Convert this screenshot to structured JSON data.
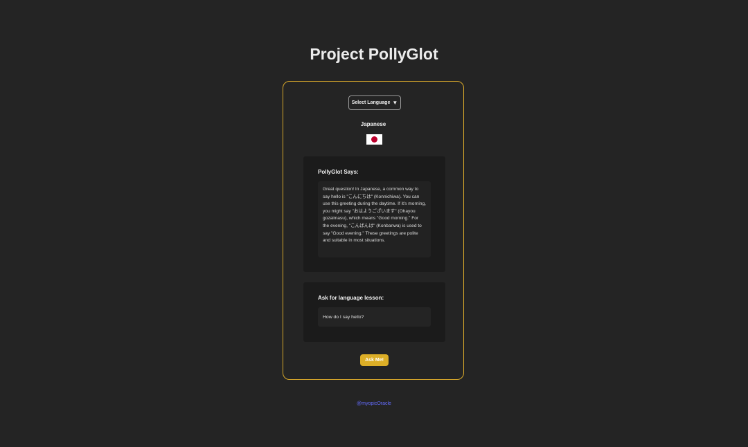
{
  "header": {
    "title": "Project PollyGlot"
  },
  "language_selector": {
    "label": "Select Language",
    "caret_icon": "▼",
    "selected_language": "Japanese",
    "flag": {
      "icon": "japan-flag",
      "field_color": "#ffffff",
      "disc_color": "#bc002d"
    }
  },
  "response_panel": {
    "heading": "PollyGlot Says:",
    "text": "Great question! In Japanese, a common way to say hello is \"こんにちは\" (Konnichiwa). You can use this greeting during the daytime. If it's morning, you might say \"おはようございます\" (Ohayou gozaimasu), which means \"Good morning.\" For the evening, \"こんばんは\" (Konbanwa) is used to say \"Good evening.\" These greetings are polite and suitable in most situations."
  },
  "question_panel": {
    "heading": "Ask for language lesson:",
    "input_value": "How do I say hello?"
  },
  "actions": {
    "ask_label": "Ask Me!"
  },
  "footer": {
    "link_text": "@myopicOracle"
  },
  "colors": {
    "background": "#242424",
    "accent": "#d9a92b",
    "button": "#dcae27",
    "link": "#646cff"
  }
}
